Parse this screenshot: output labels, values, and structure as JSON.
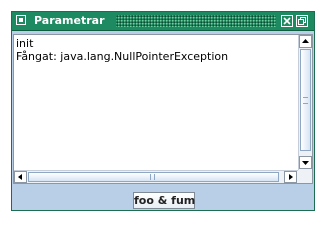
{
  "window": {
    "title": "Parametrar",
    "buttons": [
      {
        "icon": "close-x-icon"
      },
      {
        "icon": "restore-icon"
      }
    ]
  },
  "text_area": {
    "lines": [
      "init",
      "Fångat:  java.lang.NullPointerException"
    ]
  },
  "action_button": {
    "label": "foo & fum"
  },
  "colors": {
    "titlebar": "#1e8a62",
    "frame_background": "#b9cfe7",
    "content_background": "#ffffff"
  }
}
